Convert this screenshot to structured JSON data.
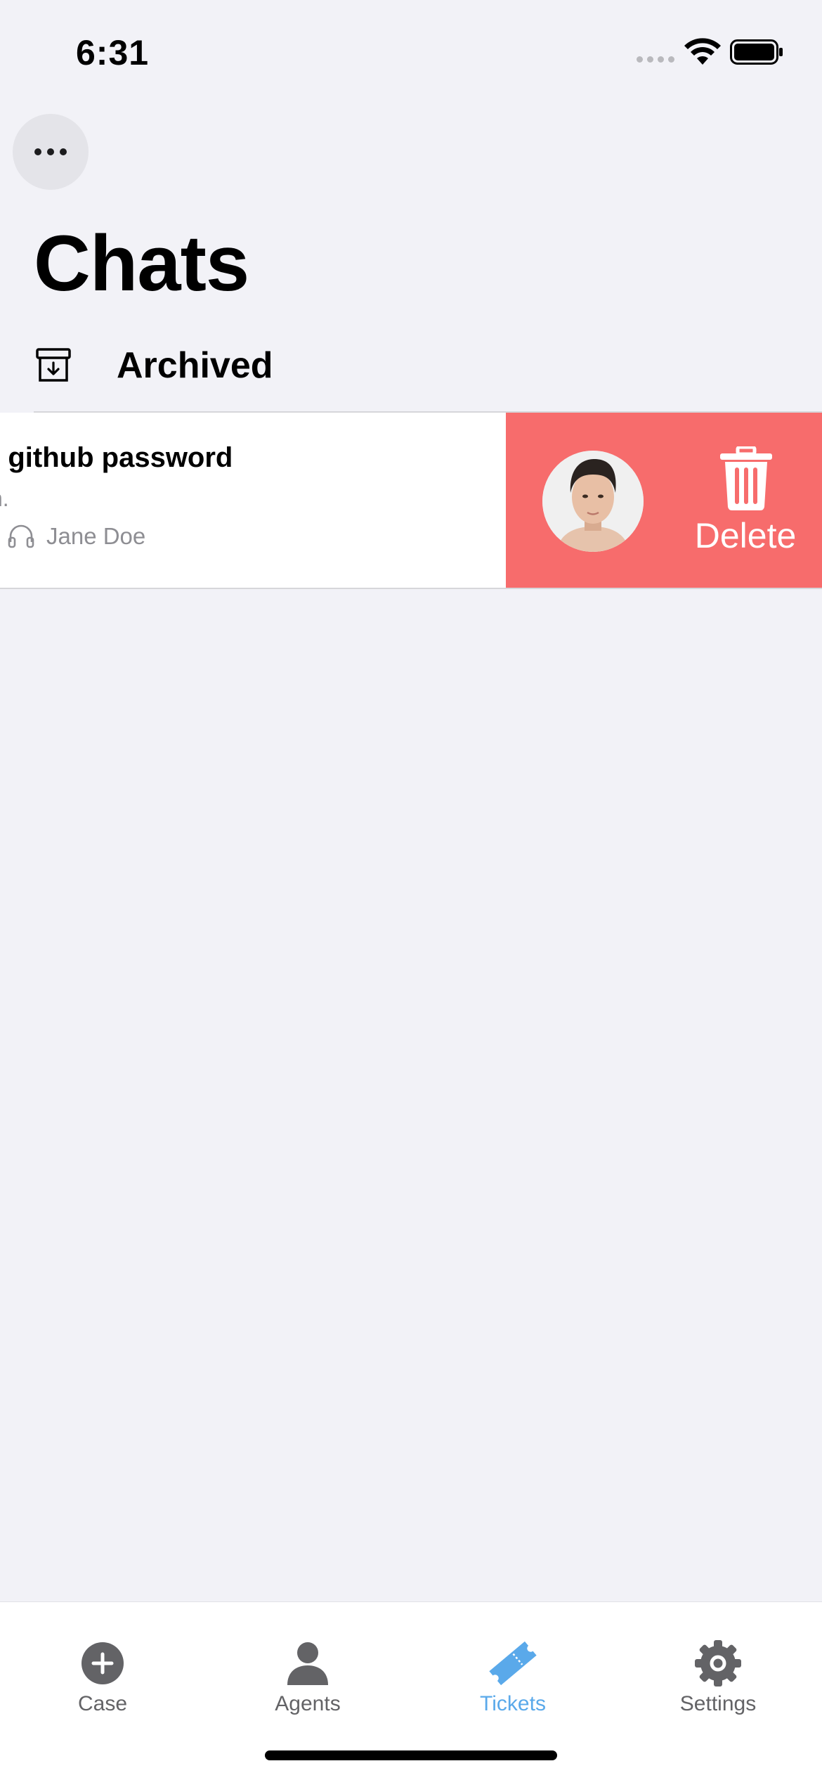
{
  "status_bar": {
    "time": "6:31"
  },
  "header": {
    "title": "Chats",
    "more_icon": "ellipsis-icon"
  },
  "archived": {
    "label": "Archived",
    "icon": "archive-box-icon"
  },
  "chat_item": {
    "title": "y github password",
    "preview": "n.",
    "agent_name": "Jane Doe",
    "agent_icon": "headset-icon"
  },
  "swipe_action": {
    "label": "Delete",
    "icon": "trash-icon",
    "color": "#f76c6c"
  },
  "tabs": [
    {
      "label": "Case",
      "icon": "plus-circle-icon"
    },
    {
      "label": "Agents",
      "icon": "person-icon"
    },
    {
      "label": "Tickets",
      "icon": "ticket-icon",
      "active": true
    },
    {
      "label": "Settings",
      "icon": "gear-icon"
    }
  ],
  "colors": {
    "accent": "#5aa9ea",
    "background": "#f2f2f7",
    "delete": "#f76c6c"
  }
}
